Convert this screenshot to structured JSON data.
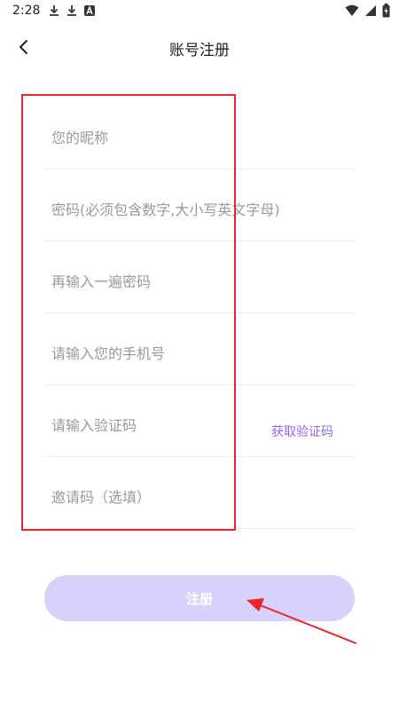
{
  "status_bar": {
    "time": "2:28"
  },
  "header": {
    "title": "账号注册"
  },
  "form": {
    "nickname_placeholder": "您的昵称",
    "password_placeholder": "密码(必须包含数字,大小写英文字母)",
    "confirm_password_placeholder": "再输入一遍密码",
    "phone_placeholder": "请输入您的手机号",
    "code_placeholder": "请输入验证码",
    "get_code_label": "获取验证码",
    "invite_placeholder": "邀请码（选填）"
  },
  "register_label": "注册",
  "colors": {
    "accent": "#8a6be3",
    "button_bg": "#d7d2fb",
    "annotation": "#e8262b"
  }
}
